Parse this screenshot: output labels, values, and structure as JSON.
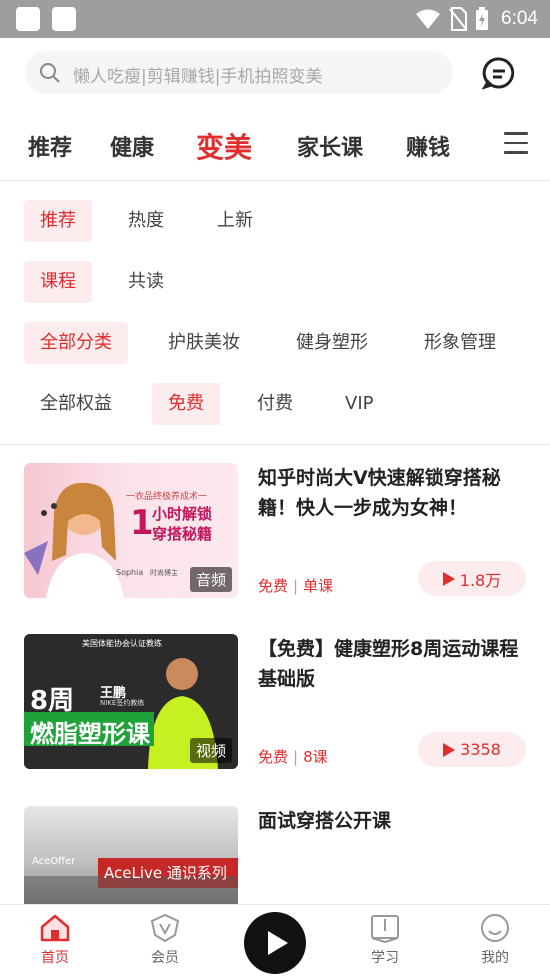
{
  "status_bar": {
    "time": "6:04",
    "icons": [
      "wifi-icon",
      "no-sim-icon",
      "battery-charging-icon"
    ]
  },
  "search": {
    "placeholder": "懒人吃瘦|剪辑赚钱|手机拍照变美"
  },
  "top_nav": {
    "items": [
      {
        "label": "推荐",
        "active": false
      },
      {
        "label": "健康",
        "active": false
      },
      {
        "label": "变美",
        "active": true
      },
      {
        "label": "家长课",
        "active": false
      },
      {
        "label": "赚钱",
        "active": false
      }
    ]
  },
  "filters": {
    "row1": [
      {
        "label": "推荐",
        "selected": true
      },
      {
        "label": "热度",
        "selected": false
      },
      {
        "label": "上新",
        "selected": false
      }
    ],
    "row2": [
      {
        "label": "课程",
        "selected": true
      },
      {
        "label": "共读",
        "selected": false
      }
    ],
    "row3": [
      {
        "label": "全部分类",
        "selected": true
      },
      {
        "label": "护肤美妆",
        "selected": false
      },
      {
        "label": "健身塑形",
        "selected": false
      },
      {
        "label": "形象管理",
        "selected": false
      }
    ],
    "row4": [
      {
        "label": "全部权益",
        "selected": false
      },
      {
        "label": "免费",
        "selected": true
      },
      {
        "label": "付费",
        "selected": false
      },
      {
        "label": "VIP",
        "selected": false
      }
    ]
  },
  "courses": [
    {
      "title": "知乎时尚大V快速解锁穿搭秘籍！快人一步成为女神！",
      "price": "免费",
      "lessons": "单课",
      "plays": "1.8万",
      "media_tag": "音频",
      "thumb": {
        "line1": "一衣品终极养成术一",
        "line2": "小时解锁",
        "line3": "穿搭秘籍",
        "num": "1",
        "caption": "Sophia",
        "caption2": "时尚博主"
      }
    },
    {
      "title": "【免费】健康塑形8周运动课程基础版",
      "price": "免费",
      "lessons": "8课",
      "plays": "3358",
      "media_tag": "视频",
      "thumb": {
        "line1": "美国体能协会认证教练",
        "big": "8周",
        "name": "王鹏",
        "sub": "NIKE签约教练",
        "banner": "燃脂塑形课"
      }
    },
    {
      "title": "面试穿搭公开课",
      "price": "",
      "lessons": "",
      "plays": "",
      "media_tag": "",
      "thumb": {
        "brand": "AceOffer",
        "banner": "AceLive 通识系列"
      }
    }
  ],
  "tab_bar": {
    "items": [
      {
        "label": "首页",
        "icon": "home-icon",
        "active": true
      },
      {
        "label": "会员",
        "icon": "vip-shield-icon",
        "active": false
      },
      {
        "label": "学习",
        "icon": "book-icon",
        "active": false
      },
      {
        "label": "我的",
        "icon": "profile-icon",
        "active": false
      }
    ]
  },
  "colors": {
    "accent": "#e02e2e",
    "chip_bg": "#fdecee",
    "status_bar": "#9e9e9e"
  }
}
